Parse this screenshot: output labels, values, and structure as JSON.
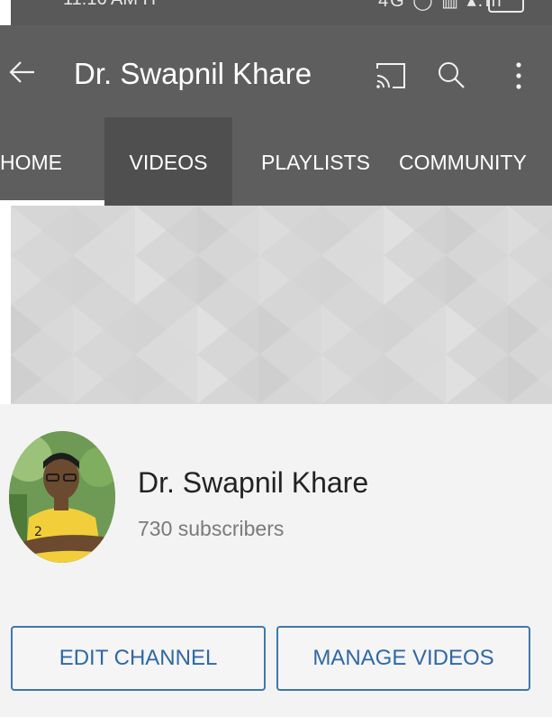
{
  "status_bar": {
    "time_clipped": "11:16 AM H",
    "system_clipped": "4G ◯ ▥ ▴.ıll"
  },
  "app_bar": {
    "title": "Dr. Swapnil Khare",
    "icons": [
      "back-arrow-icon",
      "cast-icon",
      "search-icon",
      "more-vert-icon"
    ]
  },
  "tabs": [
    {
      "label": "HOME",
      "selected": true
    },
    {
      "label": "VIDEOS",
      "selected": false,
      "pressed": true
    },
    {
      "label": "PLAYLISTS",
      "selected": false
    },
    {
      "label": "COMMUNITY",
      "selected": false
    }
  ],
  "channel": {
    "name": "Dr. Swapnil Khare",
    "subscribers": "730 subscribers"
  },
  "buttons": {
    "edit": "EDIT CHANNEL",
    "manage": "MANAGE VIDEOS"
  },
  "colors": {
    "app_bar": "#5e5e5e",
    "button_text": "#2f68a5",
    "button_border": "#3f78ad",
    "banner": "#d7d7d7"
  }
}
